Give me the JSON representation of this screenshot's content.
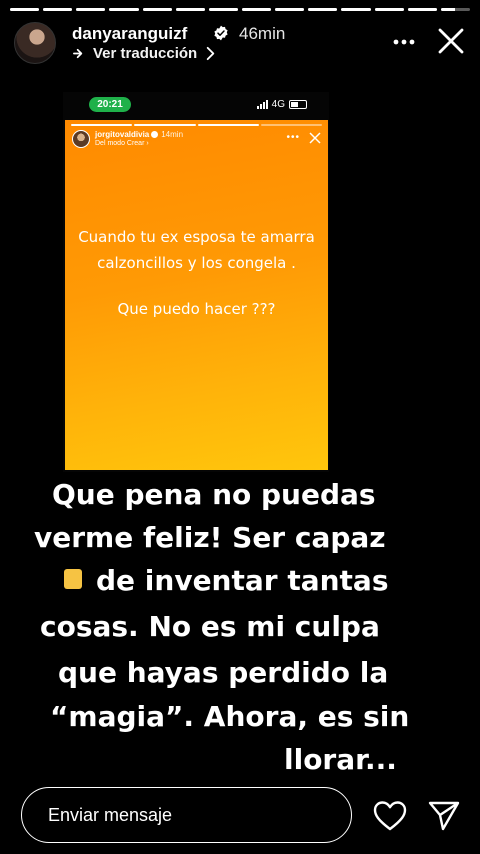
{
  "progress": {
    "segments": 14,
    "completed": 13,
    "current_fraction": 0.5
  },
  "header": {
    "username": "danyaranguizf",
    "time": "46min",
    "translate_label": "Ver traducción"
  },
  "embedded": {
    "status_time": "20:21",
    "network": "4G",
    "story_user": "jorgitovaldivia",
    "story_time": "14min",
    "story_sub": "Del modo Crear",
    "text_lines": [
      "Cuando tu ex esposa te amarra",
      "calzoncillos y los congela .",
      "",
      "Que puedo hacer ???"
    ]
  },
  "caption": {
    "lines": [
      "Que pena  no puedas",
      "verme feliz! Ser capaz",
      "de inventar tantas",
      "cosas.  No es mi culpa",
      "que hayas perdido la",
      "“magia”. Ahora, es sin",
      "llorar..."
    ]
  },
  "footer": {
    "message_placeholder": "Enviar mensaje"
  },
  "colors": {
    "background": "#000000",
    "story_orange": "#ff9a05",
    "status_pill": "#1fb14a",
    "note_yellow": "#f6c343"
  },
  "icons": [
    "verified-badge-icon",
    "chevron-right-icon",
    "more-options-icon",
    "close-icon",
    "heart-icon",
    "send-icon",
    "note-icon"
  ]
}
